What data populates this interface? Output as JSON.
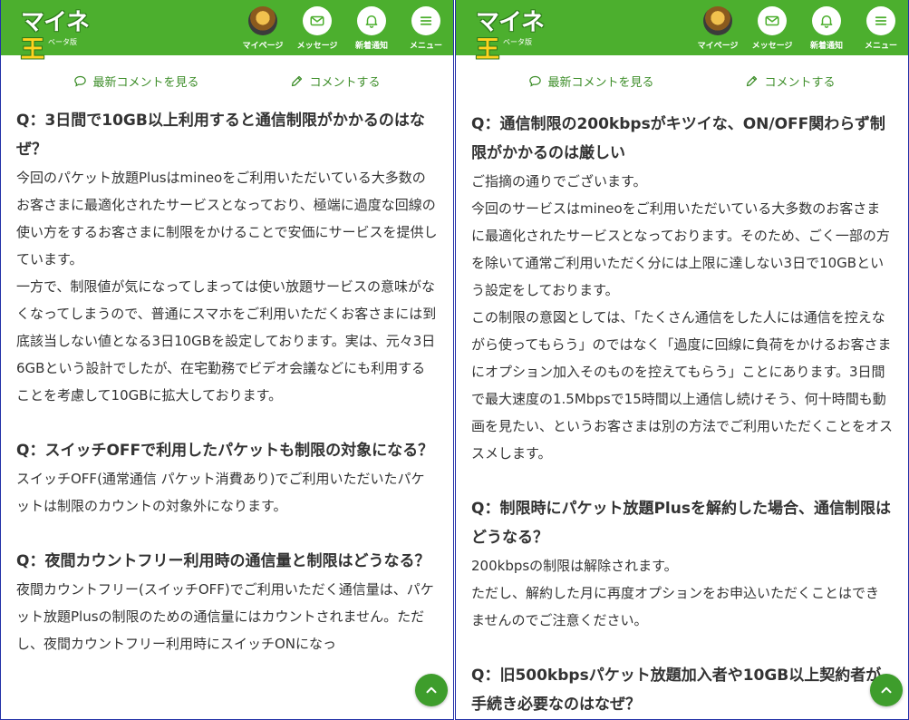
{
  "header": {
    "logo_text_a": "マイネ",
    "logo_text_b": "王",
    "logo_sub": "ベータ版",
    "nav": [
      {
        "label": "マイページ",
        "icon": "avatar"
      },
      {
        "label": "メッセージ",
        "icon": "envelope-icon"
      },
      {
        "label": "新着通知",
        "icon": "bell-icon"
      },
      {
        "label": "メニュー",
        "icon": "hamburger-icon"
      }
    ]
  },
  "actions": {
    "view_comments": "最新コメントを見る",
    "comment": "コメントする"
  },
  "colors": {
    "brand": "#4caf2e",
    "accent": "#3e8e2a"
  },
  "left": {
    "qa": [
      {
        "q": "Q：3日間で10GB以上利用すると通信制限がかかるのはなぜ？",
        "a": [
          "今回のパケット放題Plusはmineoをご利用いただいている大多数のお客さまに最適化されたサービスとなっており、極端に過度な回線の使い方をするお客さまに制限をかけることで安価にサービスを提供しています。",
          "一方で、制限値が気になってしまっては使い放題サービスの意味がなくなってしまうので、普通にスマホをご利用いただくお客さまには到底該当しない値となる3日10GBを設定しております。実は、元々3日6GBという設計でしたが、在宅勤務でビデオ会議などにも利用することを考慮して10GBに拡大しております。"
        ]
      },
      {
        "q": "Q：スイッチOFFで利用したパケットも制限の対象になる？",
        "a": [
          "スイッチOFF(通常通信 パケット消費あり)でご利用いただいたパケットは制限のカウントの対象外になります。"
        ]
      },
      {
        "q": "Q：夜間カウントフリー利用時の通信量と制限はどうなる？",
        "a": [
          "夜間カウントフリー(スイッチOFF)でご利用いただく通信量は、パケット放題Plusの制限のための通信量にはカウントされません。ただし、夜間カウントフリー利用時にスイッチONになっ"
        ]
      }
    ]
  },
  "right": {
    "qa": [
      {
        "q": "Q：通信制限の200kbpsがキツイな、ON/OFF関わらず制限がかかるのは厳しい",
        "a": [
          "ご指摘の通りでございます。",
          "今回のサービスはmineoをご利用いただいている大多数のお客さまに最適化されたサービスとなっております。そのため、ごく一部の方を除いて通常ご利用いただく分には上限に達しない3日で10GBという設定をしております。",
          "この制限の意図としては、「たくさん通信をした人には通信を控えながら使ってもらう」のではなく「過度に回線に負荷をかけるお客さまにオプション加入そのものを控えてもらう」ことにあります。3日間で最大速度の1.5Mbpsで15時間以上通信し続けそう、何十時間も動画を見たい、というお客さまは別の方法でご利用いただくことをオススメします。"
        ]
      },
      {
        "q": "Q：制限時にパケット放題Plusを解約した場合、通信制限はどうなる？",
        "a": [
          "200kbpsの制限は解除されます。",
          "ただし、解約した月に再度オプションをお申込いただくことはできませんのでご注意ください。"
        ]
      },
      {
        "q": "Q：旧500kbpsパケット放題加入者や10GB以上契約者が手続き必要なのはなぜ？",
        "a": []
      }
    ]
  }
}
